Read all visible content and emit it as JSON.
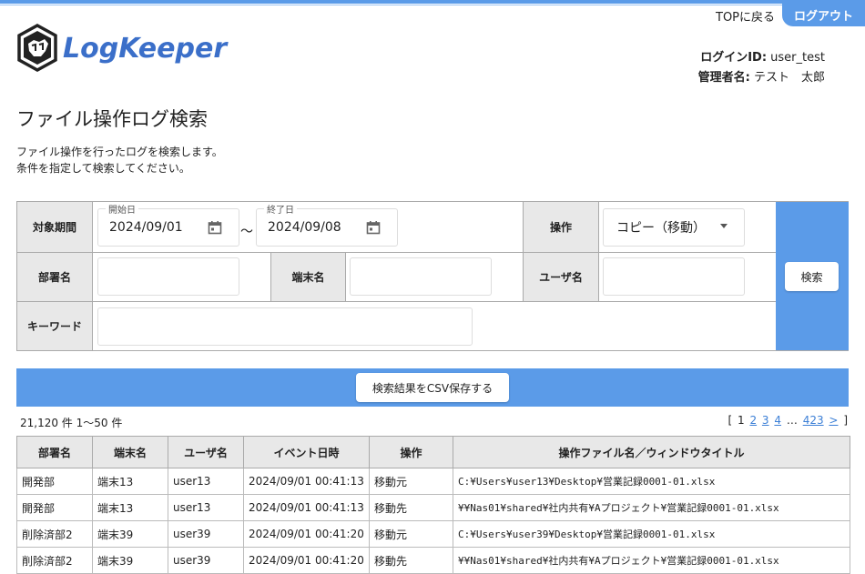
{
  "header": {
    "top_link": "TOPに戻る",
    "logout": "ログアウト",
    "brand": "LogKeeper",
    "login_id_label": "ログインID:",
    "login_id": "user_test",
    "admin_label": "管理者名:",
    "admin_name": "テスト　太郎"
  },
  "page": {
    "title": "ファイル操作ログ検索",
    "desc1": "ファイル操作を行ったログを検索します。",
    "desc2": "条件を指定して検索してください。"
  },
  "form": {
    "period_label": "対象期間",
    "start_legend": "開始日",
    "start_value": "2024/09/01",
    "tilde": "～",
    "end_legend": "終了日",
    "end_value": "2024/09/08",
    "operation_label": "操作",
    "operation_value": "コピー（移動）",
    "dept_label": "部署名",
    "terminal_label": "端末名",
    "user_label": "ユーザ名",
    "keyword_label": "キーワード",
    "search_button": "検索"
  },
  "csv_button": "検索結果をCSV保存する",
  "results": {
    "count": "21,120 件 1〜50 件",
    "pager": {
      "open": "[",
      "current": "1",
      "pages": [
        "2",
        "3",
        "4"
      ],
      "ellipsis": "…",
      "last": "423",
      "next": ">",
      "close": "]"
    }
  },
  "table": {
    "headers": [
      "部署名",
      "端末名",
      "ユーザ名",
      "イベント日時",
      "操作",
      "操作ファイル名／ウィンドウタイトル"
    ],
    "rows": [
      [
        "開発部",
        "端末13",
        "user13",
        "2024/09/01 00:41:13",
        "移動元",
        "C:¥Users¥user13¥Desktop¥営業記録0001-01.xlsx"
      ],
      [
        "開発部",
        "端末13",
        "user13",
        "2024/09/01 00:41:13",
        "移動先",
        "¥¥Nas01¥shared¥社内共有¥Aプロジェクト¥営業記録0001-01.xlsx"
      ],
      [
        "削除済部2",
        "端末39",
        "user39",
        "2024/09/01 00:41:20",
        "移動元",
        "C:¥Users¥user39¥Desktop¥営業記録0001-01.xlsx"
      ],
      [
        "削除済部2",
        "端末39",
        "user39",
        "2024/09/01 00:41:20",
        "移動先",
        "¥¥Nas01¥shared¥社内共有¥Aプロジェクト¥営業記録0001-01.xlsx"
      ]
    ]
  },
  "colors": {
    "accent": "#5b9be8",
    "label_bg": "#e8e8e8"
  },
  "icons": [
    "logo-icon",
    "calendar-icon",
    "chevron-down-icon"
  ]
}
